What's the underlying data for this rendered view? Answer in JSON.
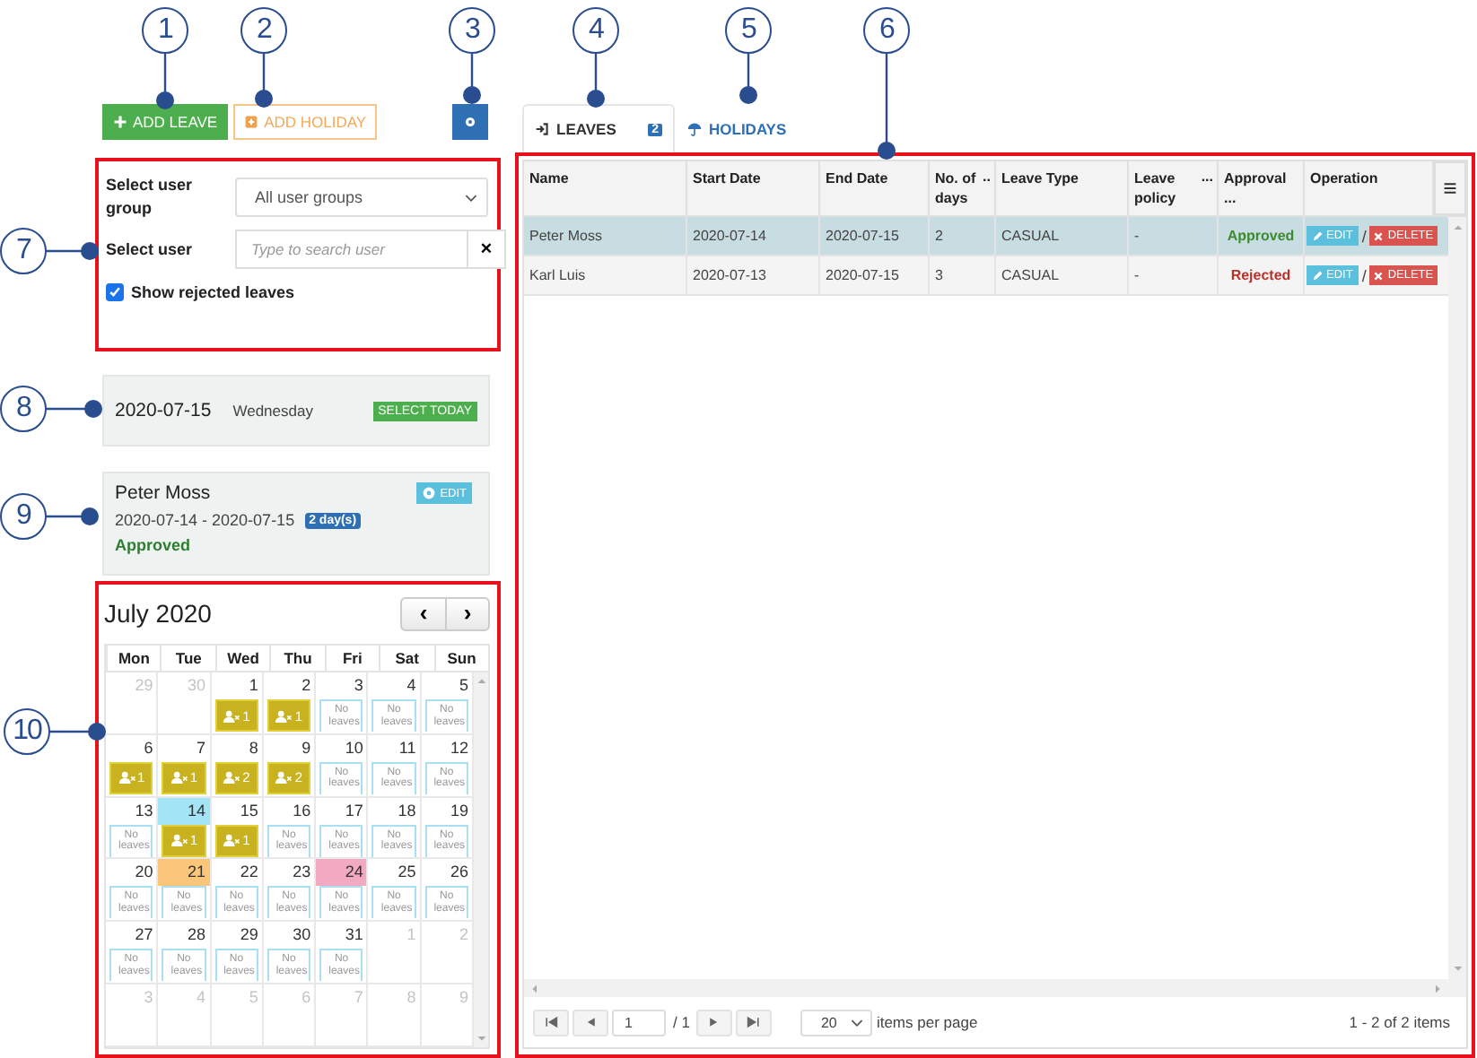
{
  "callouts": [
    {
      "number": "1"
    },
    {
      "number": "2"
    },
    {
      "number": "3"
    },
    {
      "number": "4"
    },
    {
      "number": "5"
    },
    {
      "number": "6"
    },
    {
      "number": "7"
    },
    {
      "number": "8"
    },
    {
      "number": "9"
    },
    {
      "number": "10"
    }
  ],
  "toolbar": {
    "add_leave": "ADD LEAVE",
    "add_holiday": "ADD HOLIDAY"
  },
  "filters": {
    "group_label": "Select user group",
    "group_value": "All user groups",
    "user_label": "Select user",
    "user_placeholder": "Type to search user",
    "clear": "×",
    "show_rejected": {
      "label": "Show rejected leaves",
      "checked": true
    }
  },
  "today": {
    "date": "2020-07-15",
    "weekday": "Wednesday",
    "button": "SELECT TODAY"
  },
  "selected_leave": {
    "name": "Peter Moss",
    "range": "2020-07-14 - 2020-07-15",
    "days": "2 day(s)",
    "status": "Approved",
    "edit": "EDIT"
  },
  "calendar": {
    "title": "July 2020",
    "prev": "‹",
    "next": "›",
    "weekdays": [
      "Mon",
      "Tue",
      "Wed",
      "Thu",
      "Fri",
      "Sat",
      "Sun"
    ],
    "weeks": [
      [
        {
          "day": "29",
          "kind": "other"
        },
        {
          "day": "30",
          "kind": "other"
        },
        {
          "day": "1",
          "kind": "leave",
          "count": "1"
        },
        {
          "day": "2",
          "kind": "leave",
          "count": "1"
        },
        {
          "day": "3",
          "kind": "none",
          "note": "No leaves"
        },
        {
          "day": "4",
          "kind": "none",
          "note": "No leaves"
        },
        {
          "day": "5",
          "kind": "none",
          "note": "No leaves"
        }
      ],
      [
        {
          "day": "6",
          "kind": "leave",
          "count": "1"
        },
        {
          "day": "7",
          "kind": "leave",
          "count": "1"
        },
        {
          "day": "8",
          "kind": "leave",
          "count": "2"
        },
        {
          "day": "9",
          "kind": "leave",
          "count": "2"
        },
        {
          "day": "10",
          "kind": "none",
          "note": "No leaves"
        },
        {
          "day": "11",
          "kind": "none",
          "note": "No leaves"
        },
        {
          "day": "12",
          "kind": "none",
          "note": "No leaves"
        }
      ],
      [
        {
          "day": "13",
          "kind": "none",
          "note": "No leaves"
        },
        {
          "day": "14",
          "kind": "leave",
          "count": "1",
          "color": "#a3e4f7"
        },
        {
          "day": "15",
          "kind": "leave",
          "count": "1"
        },
        {
          "day": "16",
          "kind": "none",
          "note": "No leaves"
        },
        {
          "day": "17",
          "kind": "none",
          "note": "No leaves"
        },
        {
          "day": "18",
          "kind": "none",
          "note": "No leaves"
        },
        {
          "day": "19",
          "kind": "none",
          "note": "No leaves"
        }
      ],
      [
        {
          "day": "20",
          "kind": "none",
          "note": "No leaves"
        },
        {
          "day": "21",
          "kind": "none",
          "note": "No leaves",
          "color": "#fcc67a"
        },
        {
          "day": "22",
          "kind": "none",
          "note": "No leaves"
        },
        {
          "day": "23",
          "kind": "none",
          "note": "No leaves"
        },
        {
          "day": "24",
          "kind": "none",
          "note": "No leaves",
          "color": "#f2a9c2"
        },
        {
          "day": "25",
          "kind": "none",
          "note": "No leaves"
        },
        {
          "day": "26",
          "kind": "none",
          "note": "No leaves"
        }
      ],
      [
        {
          "day": "27",
          "kind": "none",
          "note": "No leaves"
        },
        {
          "day": "28",
          "kind": "none",
          "note": "No leaves"
        },
        {
          "day": "29",
          "kind": "none",
          "note": "No leaves"
        },
        {
          "day": "30",
          "kind": "none",
          "note": "No leaves"
        },
        {
          "day": "31",
          "kind": "none",
          "note": "No leaves"
        },
        {
          "day": "1",
          "kind": "other"
        },
        {
          "day": "2",
          "kind": "other"
        }
      ],
      [
        {
          "day": "3",
          "kind": "other"
        },
        {
          "day": "4",
          "kind": "other"
        },
        {
          "day": "5",
          "kind": "other"
        },
        {
          "day": "6",
          "kind": "other"
        },
        {
          "day": "7",
          "kind": "other"
        },
        {
          "day": "8",
          "kind": "other"
        },
        {
          "day": "9",
          "kind": "other"
        }
      ]
    ]
  },
  "tabs": [
    {
      "label": "LEAVES",
      "badge": "2",
      "selected": true
    },
    {
      "label": "HOLIDAYS",
      "selected": false
    }
  ],
  "table": {
    "columns": [
      {
        "label": "Name"
      },
      {
        "label": "Start Date"
      },
      {
        "label": "End Date"
      },
      {
        "label": "No. of days",
        "more": ".."
      },
      {
        "label": "Leave Type"
      },
      {
        "label": "Leave policy",
        "more": "..."
      },
      {
        "label": "Approval ..."
      },
      {
        "label": "Operation"
      }
    ],
    "rows": [
      {
        "selected": true,
        "cells": [
          "Peter Moss",
          "2020-07-14",
          "2020-07-15",
          "2",
          "CASUAL",
          "-"
        ],
        "approval": {
          "text": "Approved",
          "color": "#3d8b2f"
        },
        "edit": "EDIT",
        "sep": "/",
        "delete": "DELETE"
      },
      {
        "selected": false,
        "cells": [
          "Karl Luis",
          "2020-07-13",
          "2020-07-15",
          "3",
          "CASUAL",
          "-"
        ],
        "approval": {
          "text": "Rejected",
          "color": "#b8322c"
        },
        "edit": "EDIT",
        "sep": "/",
        "delete": "DELETE"
      }
    ]
  },
  "pager": {
    "page": "1",
    "of": "/ 1",
    "page_size": "20",
    "per_page": "items per page",
    "summary": "1 - 2 of 2 items"
  }
}
